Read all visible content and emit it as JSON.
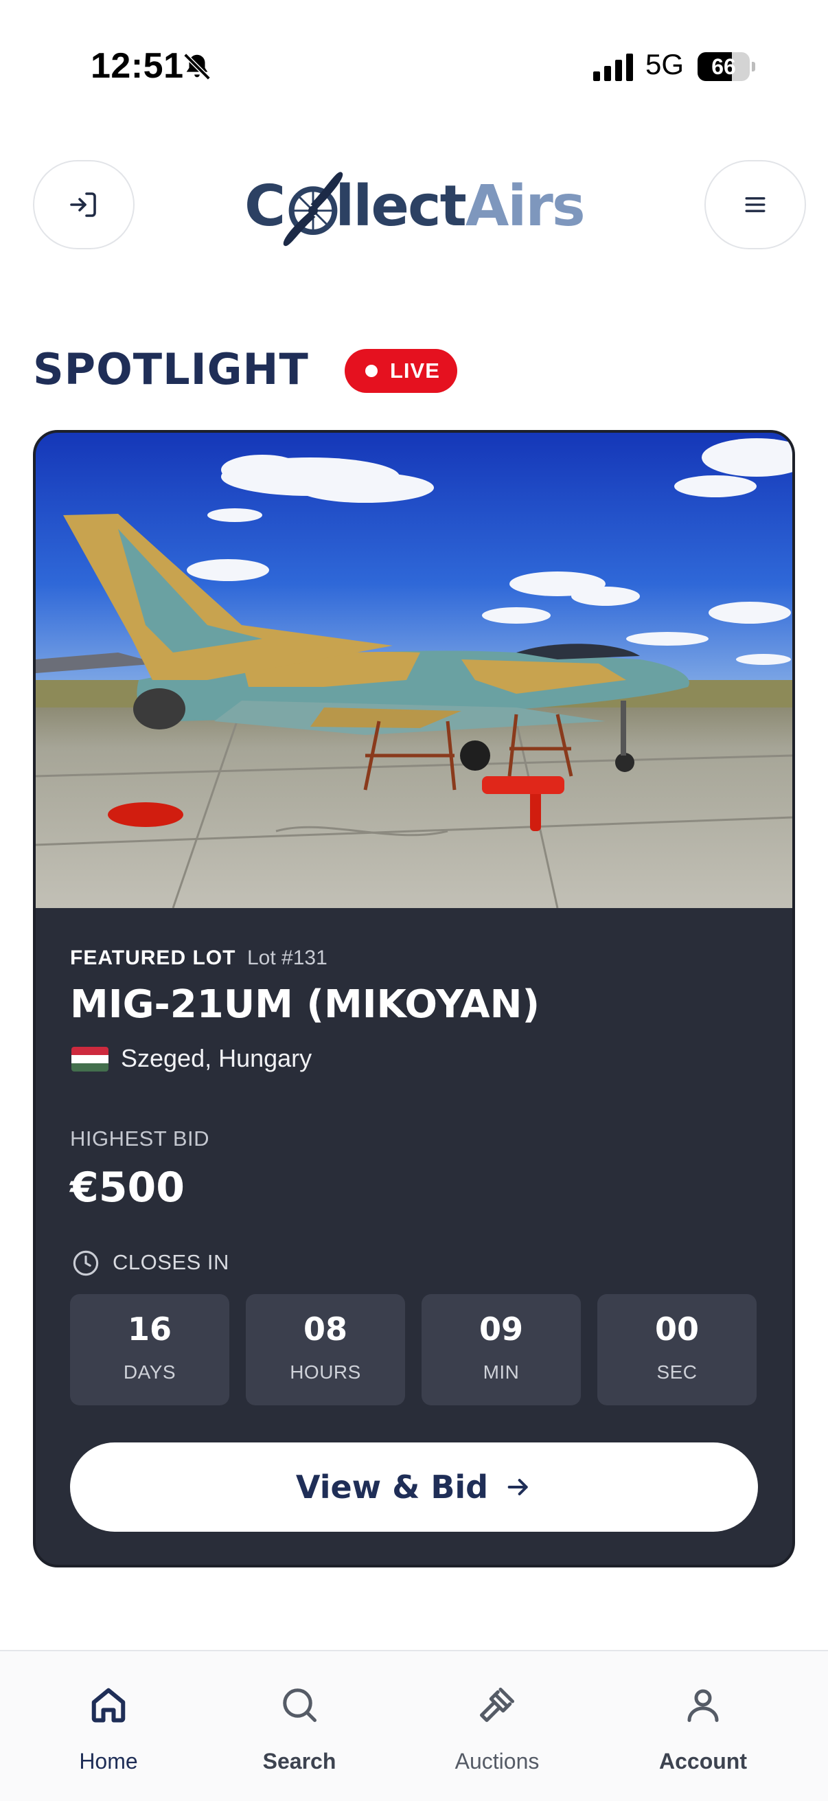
{
  "status_bar": {
    "time": "12:51",
    "network": "5G",
    "battery": "66",
    "battery_level_percent": 66,
    "icons": [
      "bell-slash-icon",
      "cellular-signal-icon",
      "battery-icon"
    ]
  },
  "header": {
    "logo_part1": "C",
    "logo_part2": "llect",
    "logo_part3": "Airs",
    "left_button_icon": "login-icon",
    "right_button_icon": "hamburger-menu-icon"
  },
  "spotlight": {
    "title": "SPOTLIGHT",
    "badge": "LIVE"
  },
  "featured": {
    "label": "FEATURED LOT",
    "lot_number": "Lot #131",
    "title": "MIG-21UM (MIKOYAN)",
    "location": "Szeged, Hungary",
    "flag_colors": [
      "#cd2a3e",
      "#ffffff",
      "#436f4d"
    ],
    "highest_bid_label": "HIGHEST BID",
    "highest_bid": "€500",
    "closes_label": "CLOSES IN",
    "countdown": [
      {
        "value": "16",
        "unit": "DAYS"
      },
      {
        "value": "08",
        "unit": "HOURS"
      },
      {
        "value": "09",
        "unit": "MIN"
      },
      {
        "value": "00",
        "unit": "SEC"
      }
    ],
    "button_label": "View & Bid"
  },
  "bottom_nav": {
    "items": [
      {
        "label": "Home",
        "icon": "home-icon",
        "active": true
      },
      {
        "label": "Search",
        "icon": "search-icon",
        "active": false
      },
      {
        "label": "Auctions",
        "icon": "gavel-icon",
        "active": false
      },
      {
        "label": "Account",
        "icon": "user-icon",
        "active": false
      }
    ]
  },
  "colors": {
    "navy": "#1f2e57",
    "card_bg": "#292d39",
    "live_red": "#e5111f",
    "logo_light": "#7e97bd"
  }
}
